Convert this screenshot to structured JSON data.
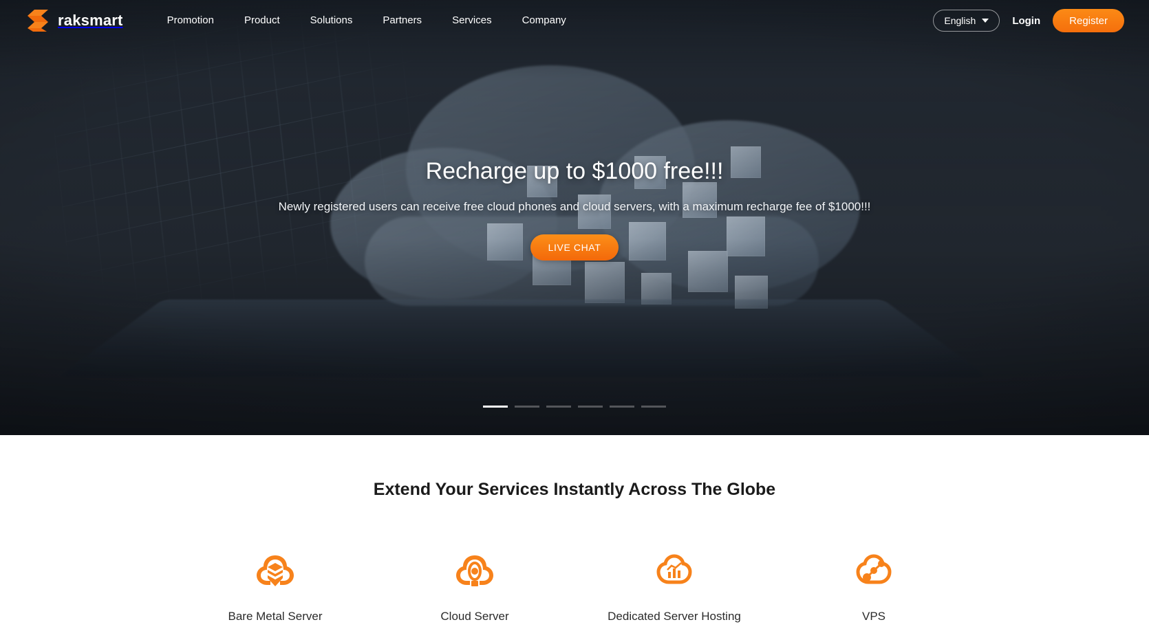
{
  "brand": {
    "name": "raksmart",
    "logo_icon": "raksmart-layered-s-logo",
    "accent_color": "#f7821b",
    "accent_color_dark": "#f3690a"
  },
  "nav": {
    "links": [
      {
        "label": "Promotion",
        "name": "nav-link-promotion"
      },
      {
        "label": "Product",
        "name": "nav-link-product"
      },
      {
        "label": "Solutions",
        "name": "nav-link-solutions"
      },
      {
        "label": "Partners",
        "name": "nav-link-partners"
      },
      {
        "label": "Services",
        "name": "nav-link-services"
      },
      {
        "label": "Company",
        "name": "nav-link-company"
      }
    ],
    "language": {
      "selected": "English",
      "chevron_icon": "chevron-down-icon"
    },
    "login_label": "Login",
    "register_label": "Register"
  },
  "hero": {
    "title": "Recharge up to $1000 free!!!",
    "subtitle": "Newly registered users can receive free cloud phones and cloud servers, with a maximum recharge fee of $1000!!!",
    "cta_label": "LIVE CHAT",
    "carousel": {
      "total": 6,
      "active_index": 0
    }
  },
  "services": {
    "heading": "Extend Your Services Instantly Across The Globe",
    "items": [
      {
        "label": "Bare Metal Server",
        "icon": "cloud-stacked-layers-icon"
      },
      {
        "label": "Cloud Server",
        "icon": "cloud-node-center-icon"
      },
      {
        "label": "Dedicated Server Hosting",
        "icon": "cloud-bar-chart-icon"
      },
      {
        "label": "VPS",
        "icon": "cloud-connected-nodes-icon"
      }
    ]
  }
}
